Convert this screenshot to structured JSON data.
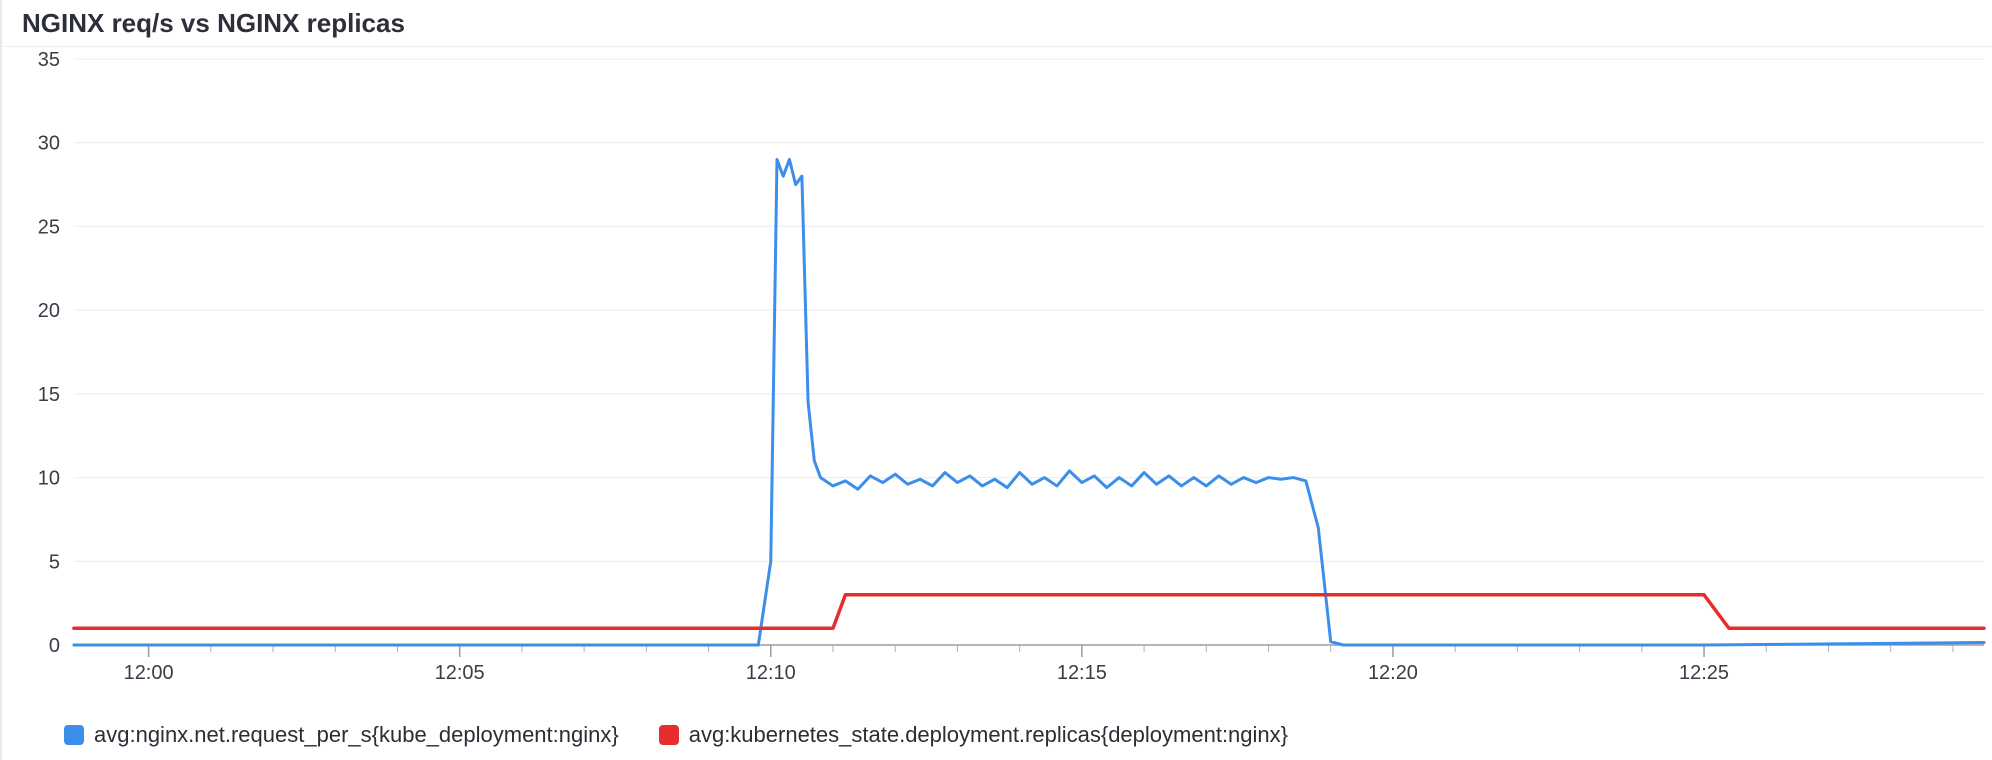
{
  "title": "NGINX req/s vs NGINX replicas",
  "legend": {
    "series1": "avg:nginx.net.request_per_s{kube_deployment:nginx}",
    "series2": "avg:kubernetes_state.deployment.replicas{deployment:nginx}"
  },
  "chart_data": {
    "type": "line",
    "title": "NGINX req/s vs NGINX replicas",
    "xlabel": "",
    "ylabel": "",
    "ylim": [
      0,
      35
    ],
    "xlim_minutes": [
      -1.2,
      29.5
    ],
    "x_major_ticks": [
      "12:00",
      "12:05",
      "12:10",
      "12:15",
      "12:20",
      "12:25"
    ],
    "y_ticks": [
      0,
      5,
      10,
      15,
      20,
      25,
      30,
      35
    ],
    "colors": {
      "series1": "#3b8eea",
      "series2": "#e62e2e"
    },
    "series": [
      {
        "name": "avg:nginx.net.request_per_s{kube_deployment:nginx}",
        "color": "#3b8eea",
        "x": [
          -1.2,
          0,
          1,
          2,
          3,
          4,
          5,
          6,
          7,
          8,
          9,
          9.8,
          10,
          10.1,
          10.2,
          10.3,
          10.4,
          10.5,
          10.6,
          10.7,
          10.8,
          11,
          11.2,
          11.4,
          11.6,
          11.8,
          12,
          12.2,
          12.4,
          12.6,
          12.8,
          13,
          13.2,
          13.4,
          13.6,
          13.8,
          14,
          14.2,
          14.4,
          14.6,
          14.8,
          15,
          15.2,
          15.4,
          15.6,
          15.8,
          16,
          16.2,
          16.4,
          16.6,
          16.8,
          17,
          17.2,
          17.4,
          17.6,
          17.8,
          18,
          18.2,
          18.4,
          18.6,
          18.8,
          19,
          19.2,
          19.4,
          20,
          25,
          29.5
        ],
        "y": [
          0,
          0,
          0,
          0,
          0,
          0,
          0,
          0,
          0,
          0,
          0,
          0,
          5,
          29,
          28,
          29,
          27.5,
          28,
          14.5,
          11,
          10,
          9.5,
          9.8,
          9.3,
          10.1,
          9.7,
          10.2,
          9.6,
          9.9,
          9.5,
          10.3,
          9.7,
          10.1,
          9.5,
          9.9,
          9.4,
          10.3,
          9.6,
          10,
          9.5,
          10.4,
          9.7,
          10.1,
          9.4,
          10,
          9.5,
          10.3,
          9.6,
          10.1,
          9.5,
          10,
          9.5,
          10.1,
          9.6,
          10,
          9.7,
          10,
          9.9,
          10,
          9.8,
          7,
          0.2,
          0,
          0,
          0,
          0,
          0.15
        ]
      },
      {
        "name": "avg:kubernetes_state.deployment.replicas{deployment:nginx}",
        "color": "#e62e2e",
        "x": [
          -1.2,
          0,
          5,
          10,
          10.6,
          11,
          11.2,
          15,
          20,
          24.6,
          25,
          25.4,
          29.5
        ],
        "y": [
          1,
          1,
          1,
          1,
          1,
          1,
          3,
          3,
          3,
          3,
          3,
          1,
          1
        ]
      }
    ]
  }
}
